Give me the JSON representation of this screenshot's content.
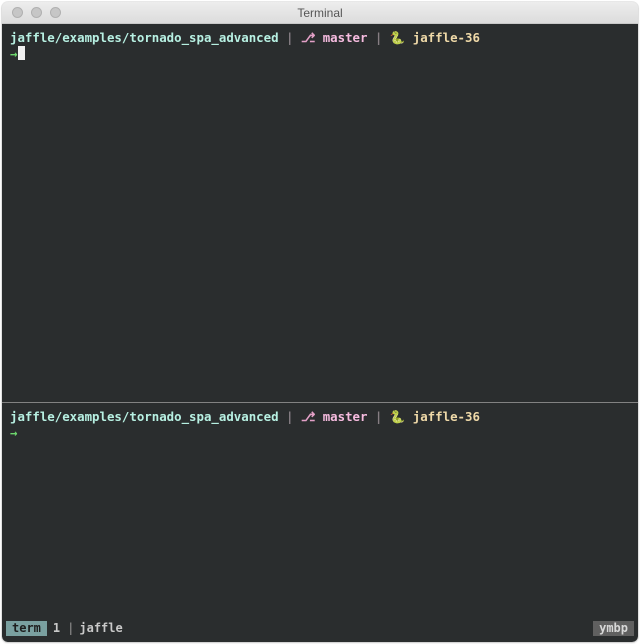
{
  "window": {
    "title": "Terminal"
  },
  "prompt": {
    "path": "jaffle/examples/tornado_spa_advanced",
    "separator": " | ",
    "branch_glyph": "⎇",
    "branch": "master",
    "env_glyph": "🐍",
    "env": "jaffle-36",
    "arrow": "→"
  },
  "status": {
    "tab_label": "term",
    "tab_index": "1",
    "bar": "|",
    "session_name": "jaffle",
    "hostname": "ymbp"
  }
}
